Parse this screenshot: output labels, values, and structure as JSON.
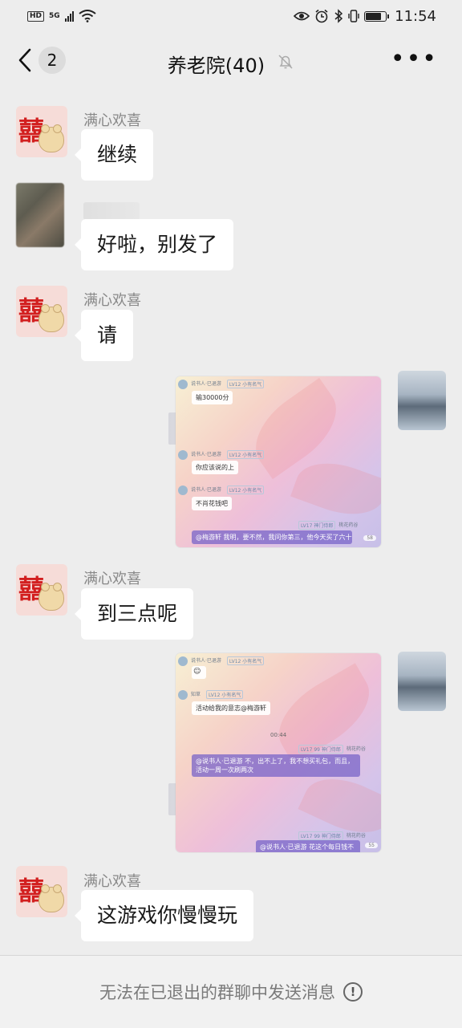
{
  "status_bar": {
    "hd_label": "HD",
    "network": "5G",
    "time": "11:54",
    "battery_percent": 85
  },
  "header": {
    "back_count": "2",
    "title": "养老院(40)",
    "muted_icon": "bell-off-icon",
    "more_icon": "more-icon",
    "more_label": "•••"
  },
  "messages": [
    {
      "type": "text",
      "sender": "满心欢喜",
      "text": "继续",
      "avatar": "xi-bear"
    },
    {
      "type": "text",
      "sender": "",
      "text": "好啦，别发了",
      "avatar": "blurred"
    },
    {
      "type": "text",
      "sender": "满心欢喜",
      "text": "请",
      "avatar": "xi-bear"
    },
    {
      "type": "image",
      "self": true,
      "content": {
        "m1_meta": "说书人·已退游",
        "m1_tag": "LV12 小有名气",
        "m1_text": "输30000分",
        "m2_meta": "说书人·已退游",
        "m2_tag": "LV12 小有名气",
        "m2_text": "你应该说的上",
        "m3_meta": "说书人·已退游",
        "m3_tag": "LV12 小有名气",
        "m3_text": "不肖花钱吧",
        "m4_tag": "LV17 神门侍郎",
        "m4_meta": "桃花药谷",
        "m4_text": "@梅游轩 我明，要不然，我问你第三，他今天买了六十个礼包更多",
        "count": "58"
      }
    },
    {
      "type": "text",
      "sender": "满心欢喜",
      "text": "到三点呢",
      "avatar": "xi-bear"
    },
    {
      "type": "image",
      "self": true,
      "content": {
        "m1_meta": "说书人·已退游",
        "m1_tag": "LV12 小有名气",
        "m2_meta": "知草",
        "m2_tag": "LV12 小有名气",
        "m2_text": "活动给我的意志@梅游轩",
        "time": "00:44",
        "m3_tag": "LV17 99 神门侍郎",
        "m3_meta": "桃花药谷",
        "m3_text": "@说书人·已退游 不，出不上了，我不想买礼包，而且，活动一周一次刷两次",
        "m4_tag": "LV17 99 神门侍郎",
        "m4_meta": "桃花药谷",
        "m4_text": "@说书人·已退游 花这个每日钱不",
        "count": "55"
      }
    },
    {
      "type": "text",
      "sender": "满心欢喜",
      "text": "这游戏你慢慢玩",
      "avatar": "xi-bear"
    }
  ],
  "footer": {
    "notice": "无法在已退出的群聊中发送消息",
    "icon": "info-icon",
    "icon_glyph": "!"
  }
}
